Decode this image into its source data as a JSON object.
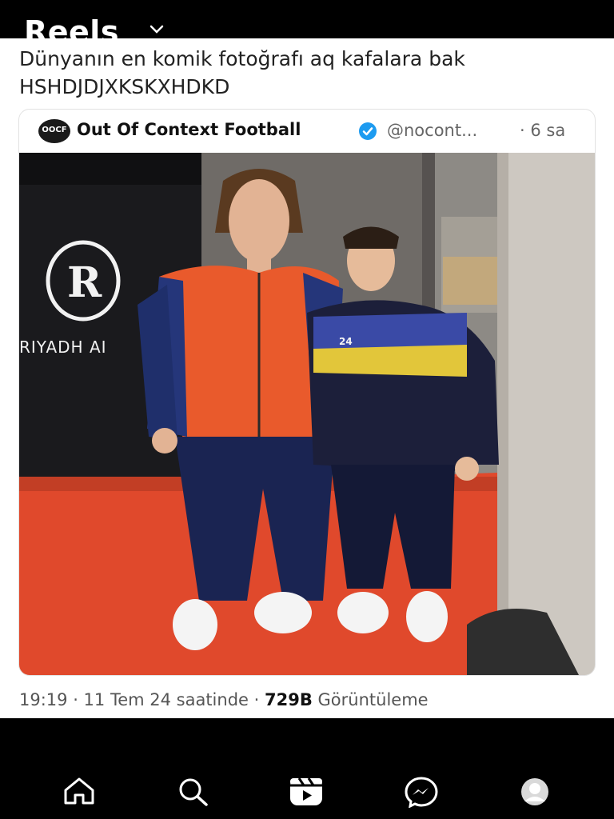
{
  "header": {
    "title": "Reels",
    "dropdown_icon": "chevron-down-icon"
  },
  "post": {
    "caption": "Dünyanın en komik fotoğrafı aq kafalara bak HSHDJDJXKSKXHDKD",
    "tweet": {
      "avatar_text": "OOCF",
      "author": "Out Of Context Football",
      "verified_icon": "verified-badge-icon",
      "handle": "@nocont...",
      "time_ago": "· 6 sa",
      "image": {
        "banner_text": "RIYADH AI",
        "logo_icon": "riyadh-air-logo-icon",
        "jersey_number": "24"
      },
      "timestamp": "19:19 · 11 Tem 24 saatinde ·",
      "views_count": "729B",
      "views_label": "Görüntüleme"
    }
  },
  "bottom_nav": {
    "items": [
      {
        "icon": "home-icon"
      },
      {
        "icon": "search-icon"
      },
      {
        "icon": "reels-icon"
      },
      {
        "icon": "messenger-icon"
      },
      {
        "icon": "profile-avatar-icon"
      }
    ]
  },
  "colors": {
    "background": "#000000",
    "card_border": "#e2e2e2",
    "verified_blue": "#1d9bf0",
    "carpet_red": "#e0492c"
  }
}
